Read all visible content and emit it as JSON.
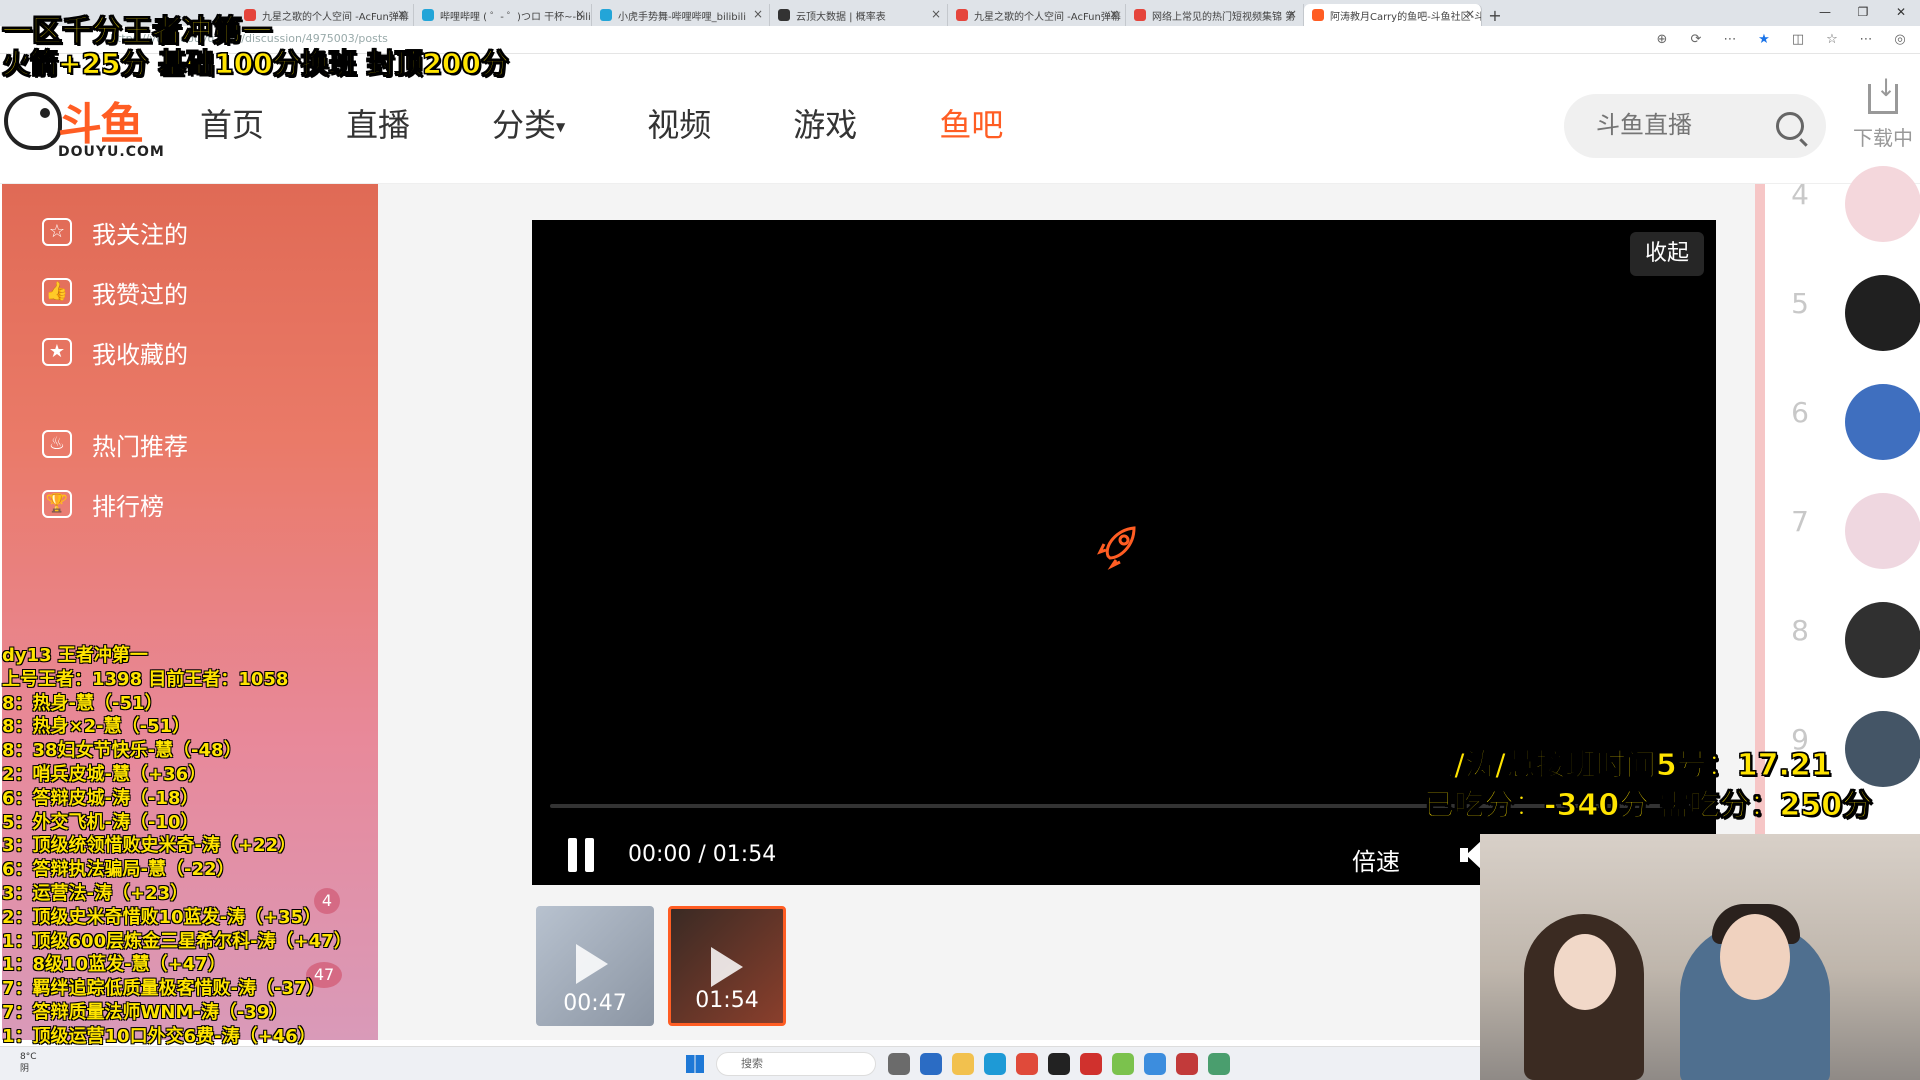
{
  "browser": {
    "tabs": [
      {
        "title": "九星之歌的个人空间 -AcFun弹幕",
        "color": "#e5453c",
        "active": false
      },
      {
        "title": "哔哩哔哩 ( ゜- ゜)つロ 干杯~-bilibi",
        "color": "#23a5d8",
        "active": false
      },
      {
        "title": "小虎手势舞-哔哩哔哩_bilibili",
        "color": "#23a5d8",
        "active": false
      },
      {
        "title": "云顶大数据 | 概率表",
        "color": "#333333",
        "active": false
      },
      {
        "title": "九星之歌的个人空间 -AcFun弹幕",
        "color": "#e5453c",
        "active": false
      },
      {
        "title": "网络上常见的热门短视频集锦 第",
        "color": "#e5453c",
        "active": false
      },
      {
        "title": "阿涛教月Carry的鱼吧-斗鱼社区-斗",
        "color": "#ff5d23",
        "active": true
      }
    ],
    "new_tab": "+",
    "url": "https://yuba.douyu.com/discussion/4975003/posts"
  },
  "header": {
    "logo_main": "斗鱼",
    "logo_sub": "DOUYU.COM",
    "nav": [
      {
        "label": "首页",
        "active": false,
        "caret": false
      },
      {
        "label": "直播",
        "active": false,
        "caret": false
      },
      {
        "label": "分类",
        "active": false,
        "caret": true
      },
      {
        "label": "视频",
        "active": false,
        "caret": false
      },
      {
        "label": "游戏",
        "active": false,
        "caret": false
      },
      {
        "label": "鱼吧",
        "active": true,
        "caret": false
      }
    ],
    "search_placeholder": "斗鱼直播",
    "download_label": "下载中"
  },
  "sidebar": {
    "items": [
      {
        "label": "我关注的",
        "icon": "☆"
      },
      {
        "label": "我赞过的",
        "icon": "👍"
      },
      {
        "label": "我收藏的",
        "icon": "★"
      },
      {
        "label": "热门推荐",
        "icon": "♨"
      },
      {
        "label": "排行榜",
        "icon": "🏆"
      }
    ]
  },
  "video": {
    "collapse_label": "收起",
    "time": "00:00 / 01:54",
    "speed_label": "倍速",
    "progress": 0
  },
  "thumbnails": [
    {
      "duration": "00:47",
      "selected": false
    },
    {
      "duration": "01:54",
      "selected": true
    }
  ],
  "rank": {
    "numbers": [
      "4",
      "5",
      "6",
      "7",
      "8",
      "9"
    ]
  },
  "badges": [
    "4",
    "47"
  ],
  "overlay": {
    "title": "一区千分王者冲第一",
    "rule": "火箭+25分  基础100分换班  封顶200分",
    "relay": "鸭/涛/慧接班时间5号：17.21",
    "eat": "已吃分：-340分  需吃分：250分",
    "score_lines": [
      "dy13 王者冲第一",
      "上号王者：1398  目前王者：1058",
      "8：热身-慧（-51）",
      "8：热身×2-慧（-51）",
      "8：38妇女节快乐-慧（-48）",
      "2：哨兵皮城-慧（+36）",
      "6：答辩皮城-涛（-18）",
      "5：外交飞机-涛（-10）",
      "3：顶级统领惜败史米奇-涛（+22）",
      "6：答辩执法骗局-慧（-22）",
      "3：运营法-涛（+23）",
      "2：顶级史米奇惜败10蓝发-涛（+35）",
      "1：顶级600层炼金三星希尔科-涛（+47）",
      "1：8级10蓝发-慧（+47）",
      "7：羁绊追踪低质量极客惜败-涛（-37）",
      "7：答辩质量法师WNM-涛（-39）",
      "1：顶级运营10口外交6费-涛（+46）"
    ]
  },
  "taskbar": {
    "weather": "8°C\n阴",
    "search_placeholder": "搜索"
  },
  "colors": {
    "accent": "#ff5d23",
    "overlay_text": "#ffe400"
  }
}
